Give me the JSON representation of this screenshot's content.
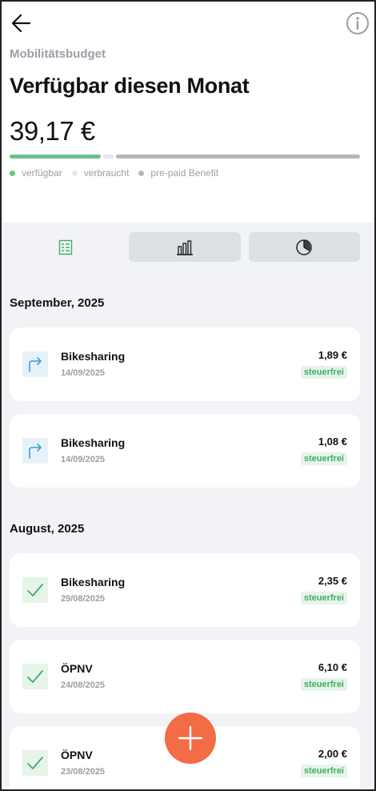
{
  "header": {
    "subtitle": "Mobilitätsbudget",
    "title": "Verfügbar diesen Monat",
    "amount": "39,17 €",
    "legend": [
      "verfügbar",
      "verbraucht",
      "pre-paid Benefit"
    ],
    "colors": {
      "available": "#6cc08b",
      "used": "#e6e8eb",
      "prepaid": "#b3b6bc"
    }
  },
  "budget_bar": {
    "available_fraction": 0.26,
    "used_fraction": 0.03,
    "prepaid_fraction": 0.71
  },
  "tabs": [
    {
      "name": "list-icon",
      "active": true
    },
    {
      "name": "bar-chart-icon",
      "active": false
    },
    {
      "name": "pie-chart-icon",
      "active": false
    }
  ],
  "sections": [
    {
      "title": "September, 2025",
      "items": [
        {
          "name": "Bikesharing",
          "date": "14/09/2025",
          "price": "1,89 €",
          "badge": "steuerfrei",
          "icon": "arrow-turn-right-icon"
        },
        {
          "name": "Bikesharing",
          "date": "14/09/2025",
          "price": "1,08 €",
          "badge": "steuerfrei",
          "icon": "arrow-turn-right-icon"
        }
      ]
    },
    {
      "title": "August, 2025",
      "items": [
        {
          "name": "Bikesharing",
          "date": "29/08/2025",
          "price": "2,35 €",
          "badge": "steuerfrei",
          "icon": "checkmark-icon"
        },
        {
          "name": "ÖPNV",
          "date": "24/08/2025",
          "price": "6,10 €",
          "badge": "steuerfrei",
          "icon": "checkmark-icon"
        },
        {
          "name": "ÖPNV",
          "date": "23/08/2025",
          "price": "2,00 €",
          "badge": "steuerfrei",
          "icon": "checkmark-icon"
        }
      ]
    }
  ]
}
